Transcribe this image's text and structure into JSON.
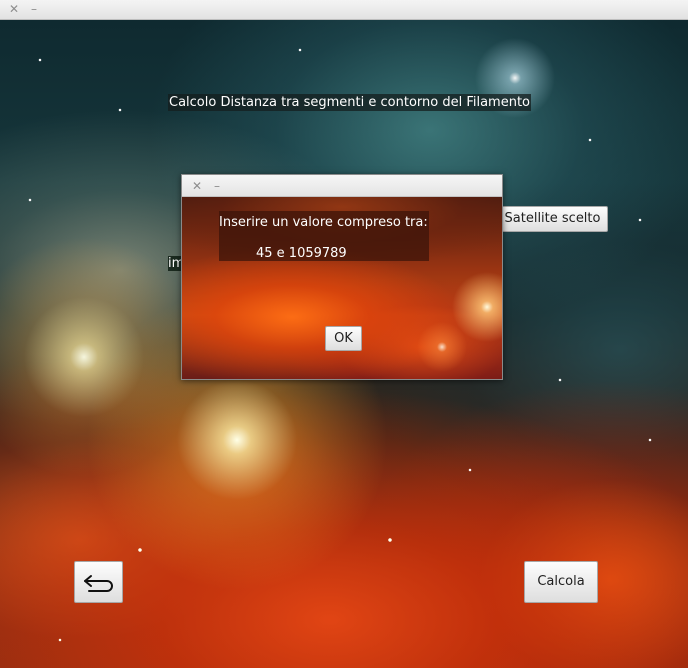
{
  "window": {
    "close_glyph": "✕",
    "minimize_glyph": "–"
  },
  "main": {
    "title": "Calcolo Distanza tra segmenti e contorno del Filamento",
    "partial_label": "im",
    "satellite_button": "Satellite scelto",
    "back_icon": "return-arrow-icon",
    "calcola_button": "Calcola"
  },
  "dialog": {
    "close_glyph": "✕",
    "minimize_glyph": "–",
    "message_line1": "Inserire un valore compreso tra:",
    "message_line2": "45 e 1059789",
    "ok_button": "OK"
  }
}
